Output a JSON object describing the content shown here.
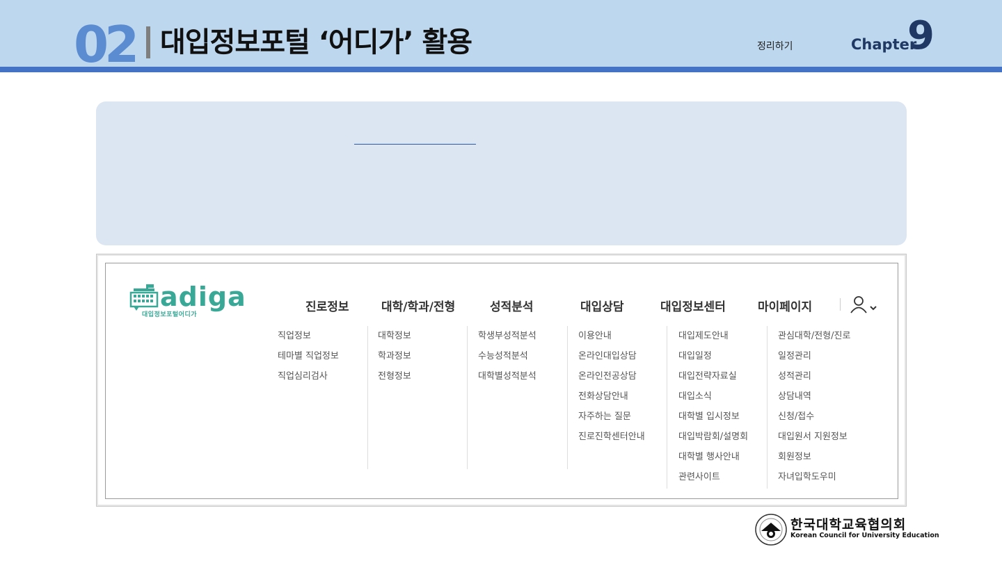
{
  "header": {
    "section_number": "02",
    "title": "대입정보포털 ‘어디가’ 활용",
    "summary_label": "정리하기",
    "chapter_label": "Chapter",
    "chapter_number": "9"
  },
  "colors": {
    "header_bg": "#bdd7ee",
    "header_bar": "#4472c4",
    "info_box_bg": "#dce6f2",
    "logo_teal": "#3aa896",
    "chapter_navy": "#1f3864"
  },
  "site": {
    "logo_word": "adiga",
    "logo_sub": "대입정보포털어디가",
    "nav": [
      {
        "label": "진로정보",
        "items": [
          "직업정보",
          "테마별 직업정보",
          "직업심리검사"
        ]
      },
      {
        "label": "대학/학과/전형",
        "items": [
          "대학정보",
          "학과정보",
          "전형정보"
        ]
      },
      {
        "label": "성적분석",
        "items": [
          "학생부성적분석",
          "수능성적분석",
          "대학별성적분석"
        ]
      },
      {
        "label": "대입상담",
        "items": [
          "이용안내",
          "온라인대입상담",
          "온라인전공상담",
          "전화상담안내",
          "자주하는 질문",
          "진로진학센터안내"
        ]
      },
      {
        "label": "대입정보센터",
        "items": [
          "대입제도안내",
          "대입일정",
          "대입전략자료실",
          "대입소식",
          "대학별 입시정보",
          "대입박람회/설명회",
          "대학별 행사안내",
          "관련사이트"
        ]
      },
      {
        "label": "마이페이지",
        "items": [
          "관심대학/전형/진로",
          "일정관리",
          "성적관리",
          "상담내역",
          "신청/접수",
          "대입원서 지원정보",
          "회원정보",
          "자녀입학도우미"
        ]
      }
    ],
    "user_icon": "user-icon"
  },
  "footer": {
    "org_name_ko": "한국대학교육협의회",
    "org_name_en": "Korean Council for University Education"
  }
}
